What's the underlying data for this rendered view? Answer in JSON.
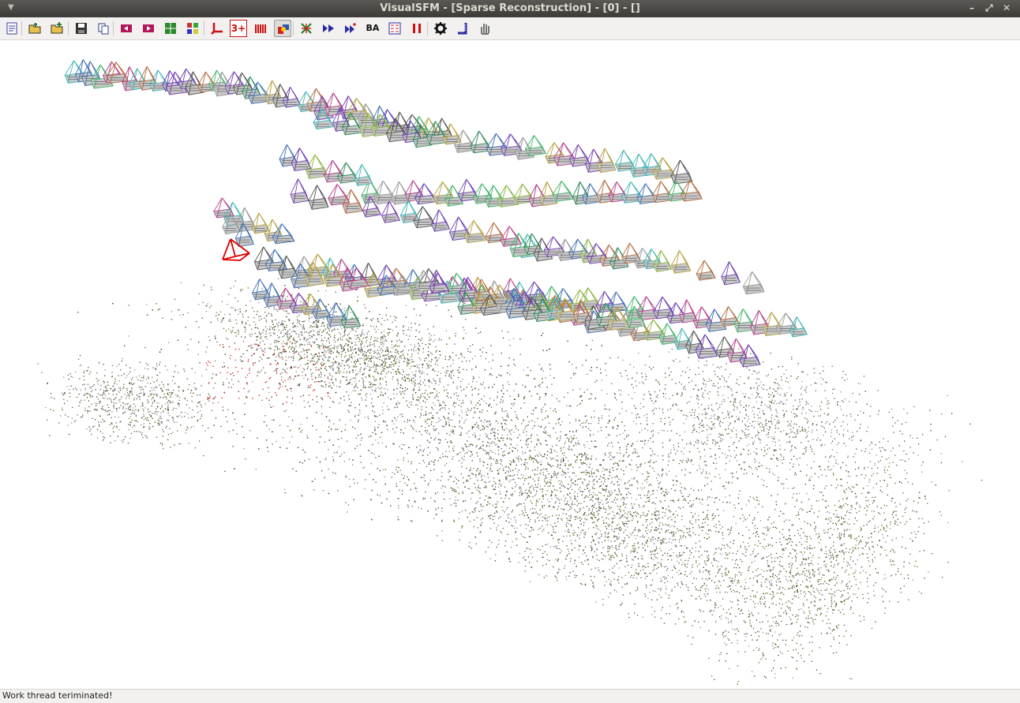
{
  "window": {
    "title": "VisualSFM - [Sparse Reconstruction] - [0] - []",
    "controls": {
      "minimize": "–",
      "maximize": "⤢",
      "close": "✕"
    }
  },
  "toolbar": {
    "buttons": [
      {
        "name": "new-log-button",
        "icon": "notepad-icon",
        "color": "#3a3aa0"
      },
      {
        "name": "open-images-button",
        "icon": "folder-open-icon",
        "color": "#2f7d2f"
      },
      {
        "name": "add-images-button",
        "icon": "folder-add-icon",
        "color": "#2f7d2f"
      },
      {
        "name": "save-button",
        "icon": "disk-icon",
        "color": "#333333"
      },
      {
        "name": "copy-button",
        "icon": "copy-icon",
        "color": "#334488"
      },
      {
        "name": "previous-button",
        "icon": "back-icon",
        "color": "#b0185a"
      },
      {
        "name": "next-button",
        "icon": "forward-icon",
        "color": "#b0185a"
      },
      {
        "name": "compute-missing-match-button",
        "icon": "match-grid-icon",
        "color": "#2a8a2a"
      },
      {
        "name": "thumbnails-button",
        "icon": "grid-icon",
        "color": "#c04040"
      },
      {
        "name": "compute-3d-button",
        "icon": "axes-icon",
        "color": "#cc1111"
      },
      {
        "name": "sparse-3d-button",
        "label": "3+",
        "icon": "three-plus-icon",
        "color": "#cc1111"
      },
      {
        "name": "matrix-view-button",
        "icon": "bars-icon",
        "color": "#cc1111"
      },
      {
        "name": "3d-view-button",
        "icon": "cube-view-icon",
        "color": "#2a55b5",
        "pressed": true
      },
      {
        "name": "feature-view-button",
        "icon": "feature-icon",
        "color": "#1a7a1a"
      },
      {
        "name": "run-forward-button",
        "icon": "double-arrow-icon",
        "color": "#2a2aa0"
      },
      {
        "name": "run-to-end-button",
        "icon": "arrow-star-icon",
        "color": "#2a2aa0"
      },
      {
        "name": "bundle-adjust-button",
        "label": "BA",
        "icon": "ba-icon",
        "color": "#111111"
      },
      {
        "name": "dense-reconstruction-button",
        "icon": "cmvs-icon",
        "color": "#2a2aa0"
      },
      {
        "name": "pause-button",
        "icon": "pause-icon",
        "color": "#cc1111"
      },
      {
        "name": "settings-button",
        "icon": "gear-icon",
        "color": "#111111"
      },
      {
        "name": "measure-button",
        "icon": "ruler-icon",
        "color": "#2a2aa0"
      },
      {
        "name": "pan-tool-button",
        "icon": "hand-icon",
        "color": "#777777"
      }
    ]
  },
  "status": {
    "text": "Work thread teriminated!"
  },
  "colors": {
    "titlebar": "#3c3b37",
    "toolbar_bg": "#f2f1f0",
    "current_camera": "#dd0000",
    "point_olive": "#5d6b1f",
    "point_gray": "#8a8a90"
  }
}
